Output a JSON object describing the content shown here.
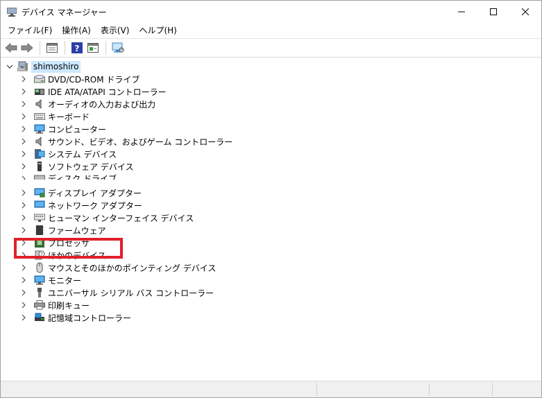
{
  "window": {
    "title": "デバイス マネージャー",
    "icon": "device-manager-icon"
  },
  "menu": [
    {
      "label": "ファイル(F)"
    },
    {
      "label": "操作(A)"
    },
    {
      "label": "表示(V)"
    },
    {
      "label": "ヘルプ(H)"
    }
  ],
  "toolbar": {
    "icons": [
      "back-arrow-icon",
      "forward-arrow-icon",
      "properties-icon",
      "help-icon",
      "update-driver-icon",
      "scan-hardware-icon"
    ]
  },
  "tree": {
    "root": "shimoshiro",
    "items": [
      {
        "label": "DVD/CD-ROM ドライブ",
        "icon": "dvd-drive-icon"
      },
      {
        "label": "IDE ATA/ATAPI コントローラー",
        "icon": "ide-controller-icon"
      },
      {
        "label": "オーディオの入力および出力",
        "icon": "audio-icon"
      },
      {
        "label": "キーボード",
        "icon": "keyboard-icon"
      },
      {
        "label": "コンピューター",
        "icon": "computer-icon"
      },
      {
        "label": "サウンド、ビデオ、およびゲーム コントローラー",
        "icon": "sound-icon"
      },
      {
        "label": "システム デバイス",
        "icon": "system-device-icon"
      },
      {
        "label": "ソフトウェア デバイス",
        "icon": "software-device-icon"
      },
      {
        "label": "ディスク ドライブ",
        "icon": "disk-drive-icon"
      },
      {
        "label": "ディスプレイ アダプター",
        "icon": "display-adapter-icon"
      },
      {
        "label": "ネットワーク アダプター",
        "icon": "network-adapter-icon"
      },
      {
        "label": "ヒューマン インターフェイス デバイス",
        "icon": "hid-icon"
      },
      {
        "label": "ファームウェア",
        "icon": "firmware-icon"
      },
      {
        "label": "プロセッサ",
        "icon": "processor-icon"
      },
      {
        "label": "ほかのデバイス",
        "icon": "other-device-icon"
      },
      {
        "label": "マウスとそのほかのポインティング デバイス",
        "icon": "mouse-icon"
      },
      {
        "label": "モニター",
        "icon": "monitor-icon"
      },
      {
        "label": "ユニバーサル シリアル バス コントローラー",
        "icon": "usb-icon"
      },
      {
        "label": "印刷キュー",
        "icon": "print-queue-icon"
      },
      {
        "label": "記憶域コントローラー",
        "icon": "storage-controller-icon"
      }
    ]
  },
  "colors": {
    "highlight": "#e0202a",
    "selection": "#cce8ff"
  }
}
